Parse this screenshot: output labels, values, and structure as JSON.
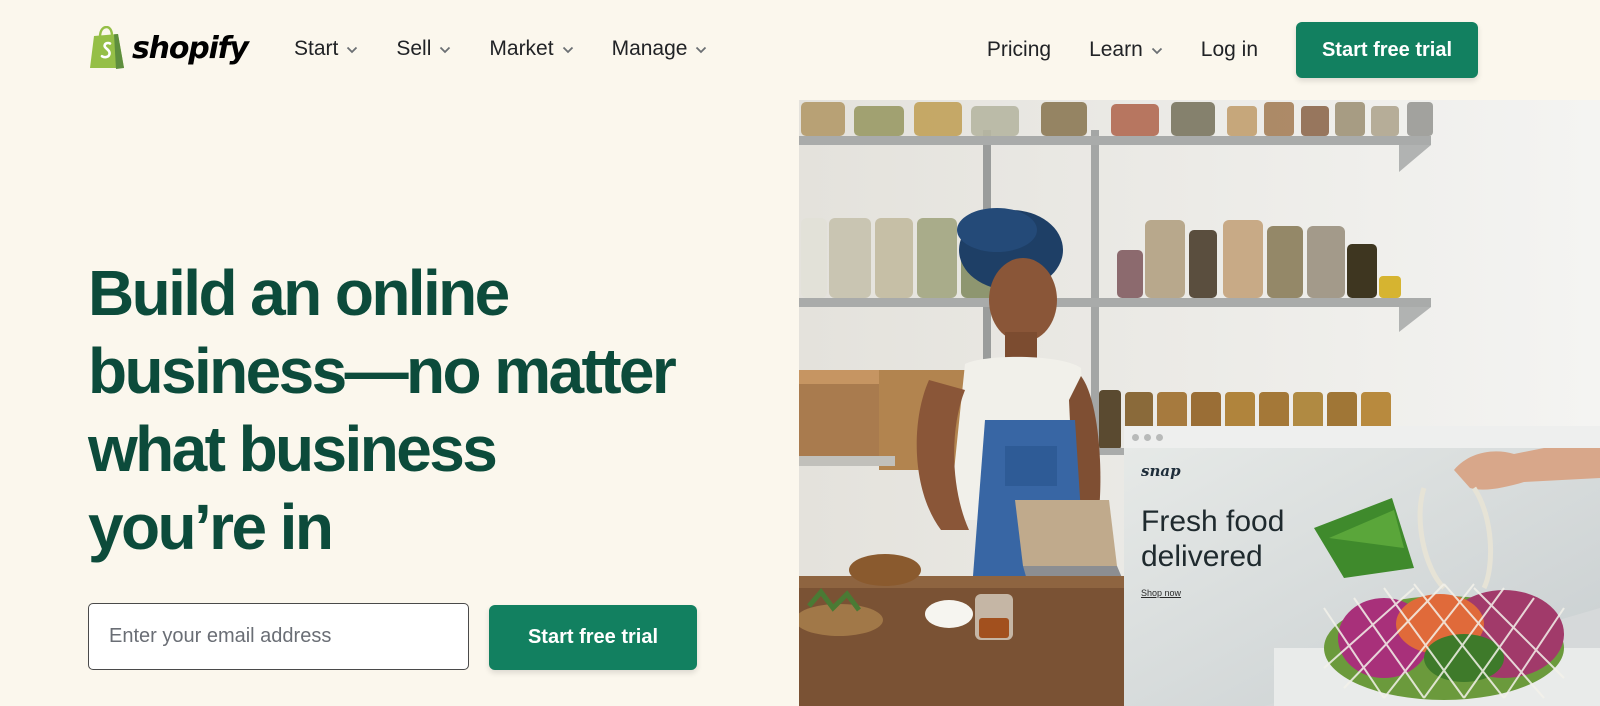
{
  "header": {
    "logo_text": "shopify",
    "nav_left": [
      {
        "label": "Start"
      },
      {
        "label": "Sell"
      },
      {
        "label": "Market"
      },
      {
        "label": "Manage"
      }
    ],
    "nav_right": {
      "pricing": "Pricing",
      "learn": "Learn",
      "login": "Log in",
      "cta": "Start free trial"
    }
  },
  "hero": {
    "title_lines": [
      "Build an online",
      "business—no matter",
      "what business",
      "you’re in"
    ],
    "email_placeholder": "Enter your email address",
    "cta": "Start free trial"
  },
  "mockup": {
    "brand": "snap",
    "heading": "Fresh food delivered",
    "link": "Shop now"
  },
  "colors": {
    "brand_green": "#128060",
    "title_green": "#0c4b3b",
    "page_bg": "#fbf7ed",
    "logo_green": "#95bf47"
  },
  "icons": [
    "shopify-bag-icon",
    "chevron-down-icon"
  ]
}
